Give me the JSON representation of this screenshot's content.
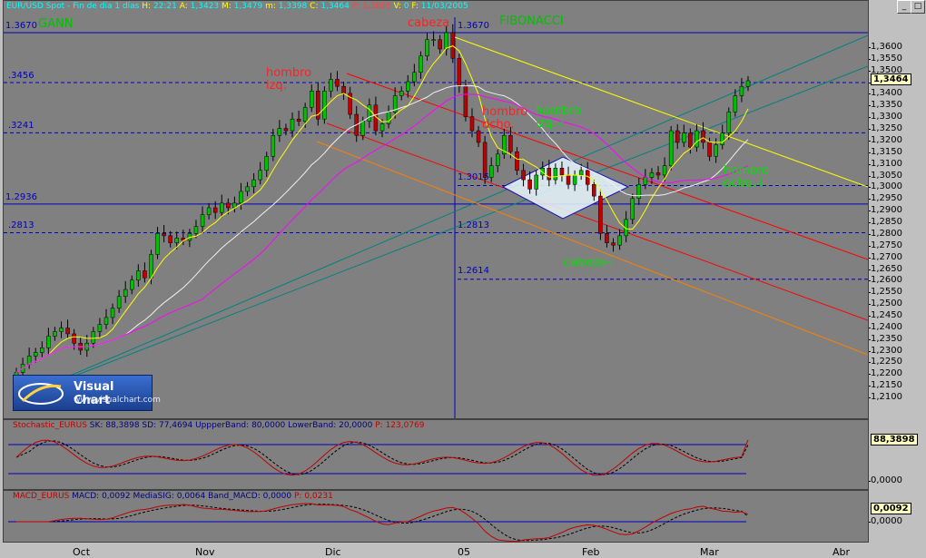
{
  "header": {
    "instrument": "EUR/USD Spot - Fin de día 1 días",
    "h_label": "H:",
    "time": "22:21",
    "a_label": "A:",
    "open": "1,3423",
    "m_label": "M:",
    "high": "1,3479",
    "m2_label": "m:",
    "low": "1,3398",
    "c_label": "C:",
    "close": "1,3464",
    "p_label": "P:",
    "prev": "1,3806",
    "v_label": "V:",
    "volume": "0",
    "f_label": "F:",
    "date": "11/03/2005"
  },
  "annotations": {
    "gann": "GANN",
    "fibonacci": "FIBONACCI",
    "cabeza": "cabeza",
    "hombro_izq": "hombro\nizq.",
    "hombro_dcho": "hombro\ndcho.",
    "hombro_izq_i": "hombro\nizq.-i",
    "cabeza_i": "cabeza-i",
    "hombro_dcho_i": "hombro\ndcho.-i"
  },
  "levels": {
    "l1": "1.3670",
    "l2": "1.3670",
    "l3": ".3456",
    "l4": ".3241",
    "l5": "1.3015",
    "l6": "1.2936",
    "l7": ".2813",
    "l8": "1.2813",
    "l9": "1.2614"
  },
  "logo": {
    "title": "Visual Chart",
    "url": "www.visualchart.com"
  },
  "price_axis": {
    "ticks": [
      "1,3600",
      "1,3550",
      "1,3500",
      "1,3450",
      "1,3400",
      "1,3350",
      "1,3300",
      "1,3250",
      "1,3200",
      "1,3150",
      "1,3100",
      "1,3050",
      "1,3000",
      "1,2950",
      "1,2900",
      "1,2850",
      "1,2800",
      "1,2750",
      "1,2700",
      "1,2650",
      "1,2600",
      "1,2550",
      "1,2500",
      "1,2450",
      "1,2400",
      "1,2350",
      "1,2300",
      "1,2250",
      "1,2200",
      "1,2150",
      "1,2100"
    ],
    "current": "1,3464"
  },
  "stoch": {
    "name": "Stochastic_EURUS",
    "sk_label": "SK:",
    "sk": "88,3898",
    "sd_label": "SD:",
    "sd": "77,4694",
    "up_label": "UppperBand:",
    "up": "80,0000",
    "low_label": "LowerBand:",
    "low": "20,0000",
    "p_label": "P:",
    "p": "123,0769",
    "axis_top": "88,3898",
    "axis_bottom": "0,0000"
  },
  "macd": {
    "name": "MACD_EURUS",
    "macd_label": "MACD:",
    "macd": "0,0092",
    "sig_label": "MediaSIG:",
    "sig": "0,0064",
    "band_label": "Band_MACD:",
    "band": "0,0000",
    "p_label": "P:",
    "p": "0,0231",
    "axis_top": "0,0092",
    "axis_bottom": "0,0000"
  },
  "months": [
    "Oct",
    "Nov",
    "Dic",
    "05",
    "Feb",
    "Mar",
    "Abr"
  ],
  "colors": {
    "panel_bg": "#808080",
    "up": "#00c000",
    "down": "#c00000",
    "gann": "#008080",
    "fib": "#0000c0",
    "trend_red": "#ff0000",
    "trend_yellow": "#ffff00",
    "trend_orange": "#ff8000",
    "ma_yellow": "#ffff00",
    "ma_white": "#f0f0f0",
    "ma_magenta": "#ff00ff"
  },
  "chart_data": {
    "type": "candlestick",
    "title": "EUR/USD Spot - Fin de día 1 días",
    "xlabel": "",
    "ylabel": "",
    "x_ticks": [
      "Oct",
      "Nov",
      "Dic",
      "05",
      "Feb",
      "Mar",
      "Abr"
    ],
    "ylim": [
      1.205,
      1.3655
    ],
    "series": [
      {
        "type": "ohlc",
        "values_summary": {
          "start": 1.22,
          "early_oct_low": 1.22,
          "late_nov_high": 1.299,
          "early_dec_high": 1.327,
          "dec_high": 1.349,
          "dec_31_peak": 1.367,
          "jan_drop": 1.3,
          "feb_low": 1.275,
          "mar_close": 1.3464
        }
      }
    ],
    "closes": [
      1.2215,
      1.225,
      1.2285,
      1.23,
      1.232,
      1.237,
      1.239,
      1.2405,
      1.238,
      1.234,
      1.231,
      1.234,
      1.239,
      1.242,
      1.245,
      1.249,
      1.254,
      1.257,
      1.261,
      1.265,
      1.262,
      1.272,
      1.281,
      1.28,
      1.277,
      1.279,
      1.278,
      1.281,
      1.284,
      1.289,
      1.292,
      1.29,
      1.294,
      1.292,
      1.294,
      1.299,
      1.301,
      1.304,
      1.308,
      1.314,
      1.323,
      1.326,
      1.325,
      1.33,
      1.329,
      1.335,
      1.342,
      1.33,
      1.342,
      1.347,
      1.344,
      1.341,
      1.332,
      1.323,
      1.329,
      1.336,
      1.325,
      1.328,
      1.333,
      1.34,
      1.342,
      1.346,
      1.35,
      1.357,
      1.364,
      1.364,
      1.36,
      1.367,
      1.356,
      1.344,
      1.331,
      1.325,
      1.32,
      1.305,
      1.31,
      1.315,
      1.323,
      1.316,
      1.308,
      1.304,
      1.3,
      1.306,
      1.309,
      1.304,
      1.309,
      1.306,
      1.302,
      1.306,
      1.308,
      1.302,
      1.297,
      1.281,
      1.277,
      1.276,
      1.28,
      1.287,
      1.296,
      1.302,
      1.305,
      1.307,
      1.306,
      1.31,
      1.325,
      1.32,
      1.324,
      1.318,
      1.325,
      1.32,
      1.314,
      1.319,
      1.324,
      1.333,
      1.34,
      1.344,
      1.3464
    ],
    "oct_to_mar_dates": [
      "Oct",
      "Nov",
      "Dic",
      "05",
      "Feb",
      "Mar"
    ],
    "fibonacci_levels": [
      1.367,
      1.3456,
      1.3241,
      1.3015,
      1.2936,
      1.2813,
      1.2614
    ],
    "stochastic": {
      "sk_last": 88.3898,
      "sd_last": 77.4694,
      "upper_band": 80,
      "lower_band": 20
    },
    "macd": {
      "macd_last": 0.0092,
      "signal_last": 0.0064,
      "band": 0
    }
  }
}
